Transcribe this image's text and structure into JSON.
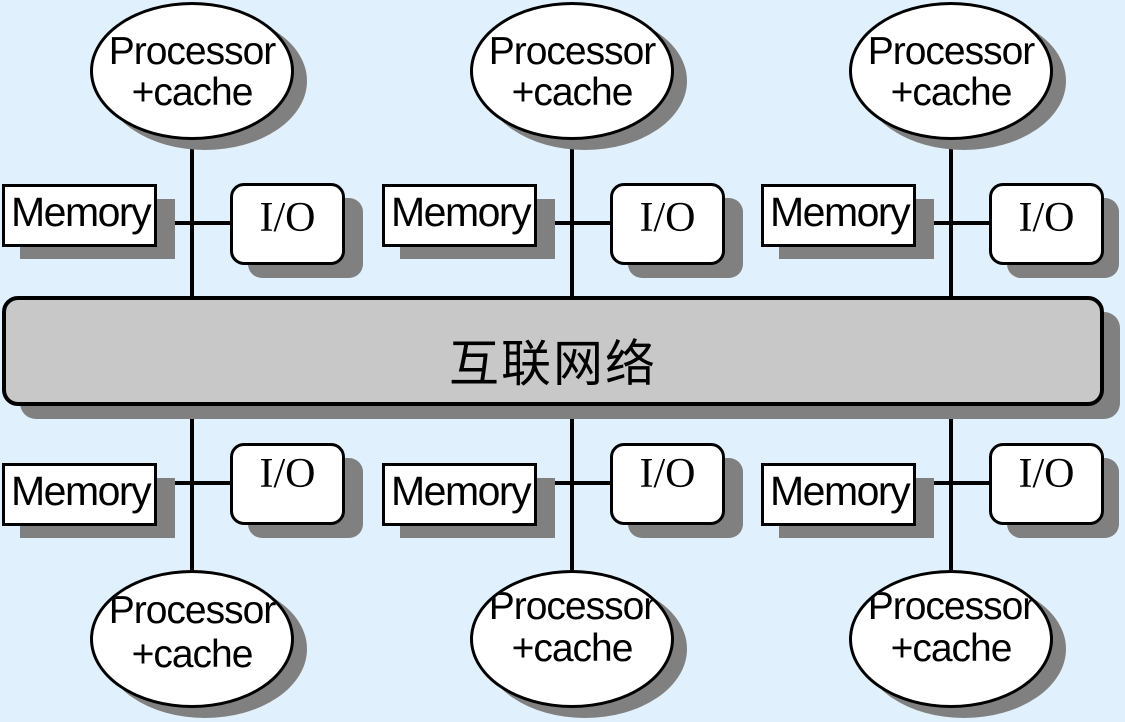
{
  "diagram": {
    "network_label": "互联网络",
    "top_nodes": [
      {
        "processor_line1": "Processor",
        "processor_line2": "+cache",
        "memory_label": "Memory",
        "io_label": "I/O"
      },
      {
        "processor_line1": "Processor",
        "processor_line2": "+cache",
        "memory_label": "Memory",
        "io_label": "I/O"
      },
      {
        "processor_line1": "Processor",
        "processor_line2": "+cache",
        "memory_label": "Memory",
        "io_label": "I/O"
      }
    ],
    "bottom_nodes": [
      {
        "processor_line1": "Processor",
        "processor_line2": "+cache",
        "memory_label": "Memory",
        "io_label": "I/O"
      },
      {
        "processor_line1": "Processor",
        "processor_line2": "+cache",
        "memory_label": "Memory",
        "io_label": "I/O"
      },
      {
        "processor_line1": "Processor",
        "processor_line2": "+cache",
        "memory_label": "Memory",
        "io_label": "I/O"
      }
    ]
  }
}
